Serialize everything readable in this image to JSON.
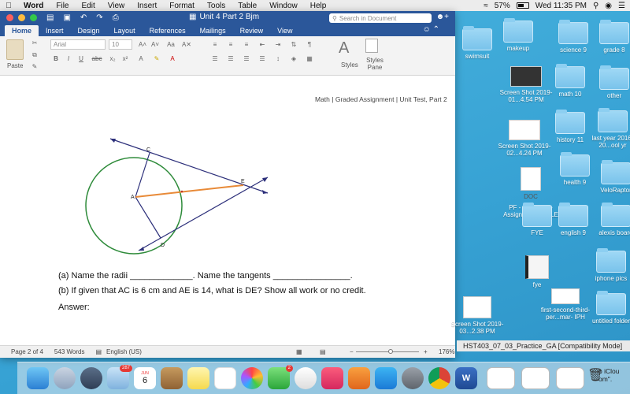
{
  "menubar": {
    "app_name": "Word",
    "items": [
      "File",
      "Edit",
      "View",
      "Insert",
      "Format",
      "Tools",
      "Table",
      "Window",
      "Help"
    ],
    "battery": "57%",
    "clock": "Wed 11:35 PM"
  },
  "window": {
    "title": "Unit 4 Part 2 Bjm",
    "search_placeholder": "Search in Document"
  },
  "ribbon": {
    "tabs": [
      "Home",
      "Insert",
      "Design",
      "Layout",
      "References",
      "Mailings",
      "Review",
      "View"
    ],
    "active_tab": "Home",
    "paste_label": "Paste",
    "font_name": "Arial",
    "font_size": "10",
    "styles_label": "Styles",
    "styles_pane_label": "Styles Pane"
  },
  "document": {
    "header": "Math | Graded Assignment | Unit Test, Part 2",
    "points": {
      "c": "C",
      "a": "A",
      "e": "E",
      "d": "D"
    },
    "question_a": "(a)  Name the radii _____________.  Name the tangents ________________.",
    "question_b": "(b)  If given that AC is 6 cm and AE is 14, what is DE?  Show all work or no credit.",
    "answer_label": "Answer:"
  },
  "statusbar": {
    "page": "Page 2 of 4",
    "words": "543 Words",
    "language": "English (US)",
    "zoom": "176%",
    "zoom_fraction": 0.55
  },
  "desktop_icons": [
    {
      "label": "swimsuit"
    },
    {
      "label": "makeup"
    },
    {
      "label": "science 9"
    },
    {
      "label": "grade 8"
    },
    {
      "label": "Screen Shot 2019-01...4.54 PM"
    },
    {
      "label": "math 10"
    },
    {
      "label": "other"
    },
    {
      "label": "Screen Shot 2019-02...4.24 PM"
    },
    {
      "label": "history 11"
    },
    {
      "label": "last year 2016-20...ool yr"
    },
    {
      "label": "DOC"
    },
    {
      "label": "PF - Section 3 - Assignm...XAMPLE"
    },
    {
      "label": "health 9"
    },
    {
      "label": "VeloRaptor"
    },
    {
      "label": "FYE"
    },
    {
      "label": "english 9"
    },
    {
      "label": "alexis board"
    },
    {
      "label": "fye"
    },
    {
      "label": "iphone pics"
    },
    {
      "label": "first-second-third-per...mar- IPH"
    },
    {
      "label": "untitled folder"
    },
    {
      "label": "Screen Shot 2019-03...2.38 PM"
    }
  ],
  "compat_bar": "HST403_07_03_Practice_GA [Compatibility Mode]",
  "dock": {
    "calendar_month": "JUN",
    "calendar_day": "6",
    "badge_photos": "287",
    "badge_messages": "2",
    "notice_line1": "o iClou",
    "notice_line2": "om\"."
  }
}
